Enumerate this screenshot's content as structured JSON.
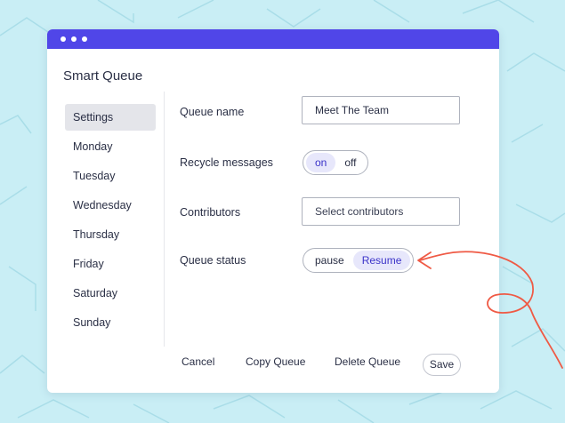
{
  "window": {
    "title": "Smart Queue"
  },
  "sidebar": {
    "items": [
      {
        "label": "Settings",
        "active": true
      },
      {
        "label": "Monday"
      },
      {
        "label": "Tuesday"
      },
      {
        "label": "Wednesday"
      },
      {
        "label": "Thursday"
      },
      {
        "label": "Friday"
      },
      {
        "label": "Saturday"
      },
      {
        "label": "Sunday"
      }
    ]
  },
  "form": {
    "queue_name": {
      "label": "Queue name",
      "value": "Meet The Team"
    },
    "recycle": {
      "label": "Recycle messages",
      "on_label": "on",
      "off_label": "off",
      "selected": "on"
    },
    "contributors": {
      "label": "Contributors",
      "placeholder": "Select contributors"
    },
    "status": {
      "label": "Queue status",
      "pause_label": "pause",
      "resume_label": "Resume",
      "selected": "Resume"
    }
  },
  "footer": {
    "cancel_label": "Cancel",
    "copy_label": "Copy Queue",
    "delete_label": "Delete Queue",
    "save_label": "Save"
  },
  "colors": {
    "background": "#c9eef5",
    "titlebar": "#5046e8",
    "accent_pill": "#e7e7fb",
    "annotation_arrow": "#ef5a45"
  }
}
